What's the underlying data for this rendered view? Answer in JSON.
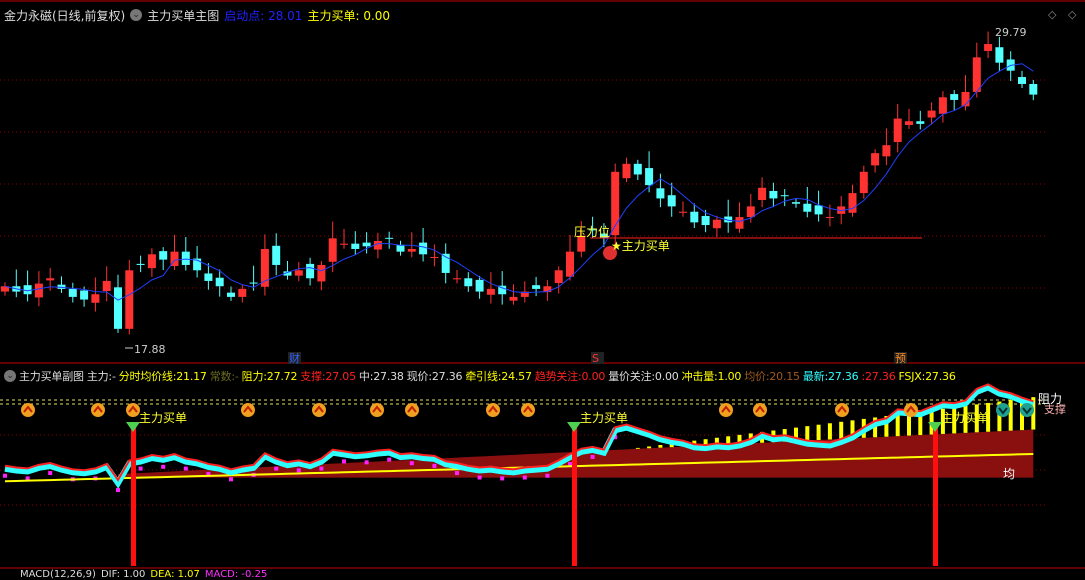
{
  "main_header": {
    "title": "金力永磁(日线,前复权)",
    "indicator": "主力买单主图",
    "start_label": "启动点",
    "start_value": "28.01",
    "buy_label": "主力买单",
    "buy_value": "0.00"
  },
  "sub_header": {
    "indicator": "主力买单副图",
    "items": [
      {
        "label": "主力",
        "value": "-",
        "color": "#dddddd"
      },
      {
        "label": "分时均价线",
        "value": "21.17",
        "color": "#ffff00"
      },
      {
        "label": "常数",
        "value": "-",
        "color": "#6a6a20"
      },
      {
        "label": "阻力",
        "value": "27.72",
        "color": "#ffff00"
      },
      {
        "label": "支撑",
        "value": "27.05",
        "color": "#ff2020"
      },
      {
        "label": "中",
        "value": "27.38",
        "color": "#dddddd"
      },
      {
        "label": "现价",
        "value": "27.36",
        "color": "#dddddd"
      },
      {
        "label": "牵引线",
        "value": "24.57",
        "color": "#ffff00"
      },
      {
        "label": "趋势关注",
        "value": "0.00",
        "color": "#ff2020"
      },
      {
        "label": "量价关注",
        "value": "0.00",
        "color": "#dddddd"
      },
      {
        "label": "冲击量",
        "value": "1.00",
        "color": "#ffff00"
      },
      {
        "label": "均价",
        "value": "20.15",
        "color": "#a05a20"
      },
      {
        "label": "最新",
        "value": "27.36",
        "color": "#30ffff"
      },
      {
        "label": "",
        "value": "27.36",
        "color": "#ff2020"
      },
      {
        "label": "FSJX",
        "value": "27.36",
        "color": "#ffff00"
      }
    ]
  },
  "macd_header": {
    "title": "MACD(12,26,9)",
    "dif": "DIF: 1.00",
    "dea": "DEA: 1.07",
    "macd": "MACD: -0.25"
  },
  "labels": {
    "high": "29.79",
    "low": "17.88",
    "pressure": "压力位",
    "buy_main": "★主力买单",
    "buy_sub": "主力买单",
    "resist": "阻力",
    "support": "支撑",
    "avg": "均",
    "event_cai": "财",
    "event_s": "S",
    "event_yu": "预"
  },
  "colors": {
    "up": "#ff3232",
    "down": "#54ffff",
    "ma": "#2040ff",
    "grid": "#8a0000"
  },
  "chart_data": {
    "type": "candlestick",
    "price_range": [
      17.88,
      29.79
    ],
    "closes": [
      20.2,
      20.0,
      19.9,
      20.3,
      20.5,
      20.1,
      19.8,
      19.7,
      19.9,
      20.4,
      18.6,
      20.8,
      21.0,
      21.4,
      21.2,
      21.5,
      21.0,
      20.8,
      20.4,
      20.2,
      19.8,
      20.1,
      20.3,
      21.6,
      21.0,
      20.6,
      20.8,
      20.5,
      21.0,
      22.0,
      21.8,
      21.6,
      21.7,
      21.9,
      22.0,
      21.5,
      21.6,
      21.4,
      21.3,
      20.7,
      20.5,
      20.2,
      20.0,
      20.1,
      19.9,
      19.8,
      20.0,
      20.1,
      20.2,
      20.8,
      21.5,
      22.1,
      22.3,
      22.0,
      24.5,
      24.8,
      24.4,
      24.0,
      23.5,
      23.2,
      23.0,
      22.6,
      22.5,
      22.7,
      22.6,
      22.8,
      23.2,
      23.9,
      23.5,
      23.6,
      23.3,
      23.0,
      22.9,
      22.8,
      23.2,
      23.7,
      24.5,
      25.2,
      25.5,
      26.5,
      26.4,
      26.3,
      26.8,
      27.3,
      27.2,
      27.5,
      28.8,
      29.3,
      28.6,
      28.3,
      27.8,
      27.4
    ],
    "buy_signals": [
      11,
      50,
      82
    ]
  }
}
